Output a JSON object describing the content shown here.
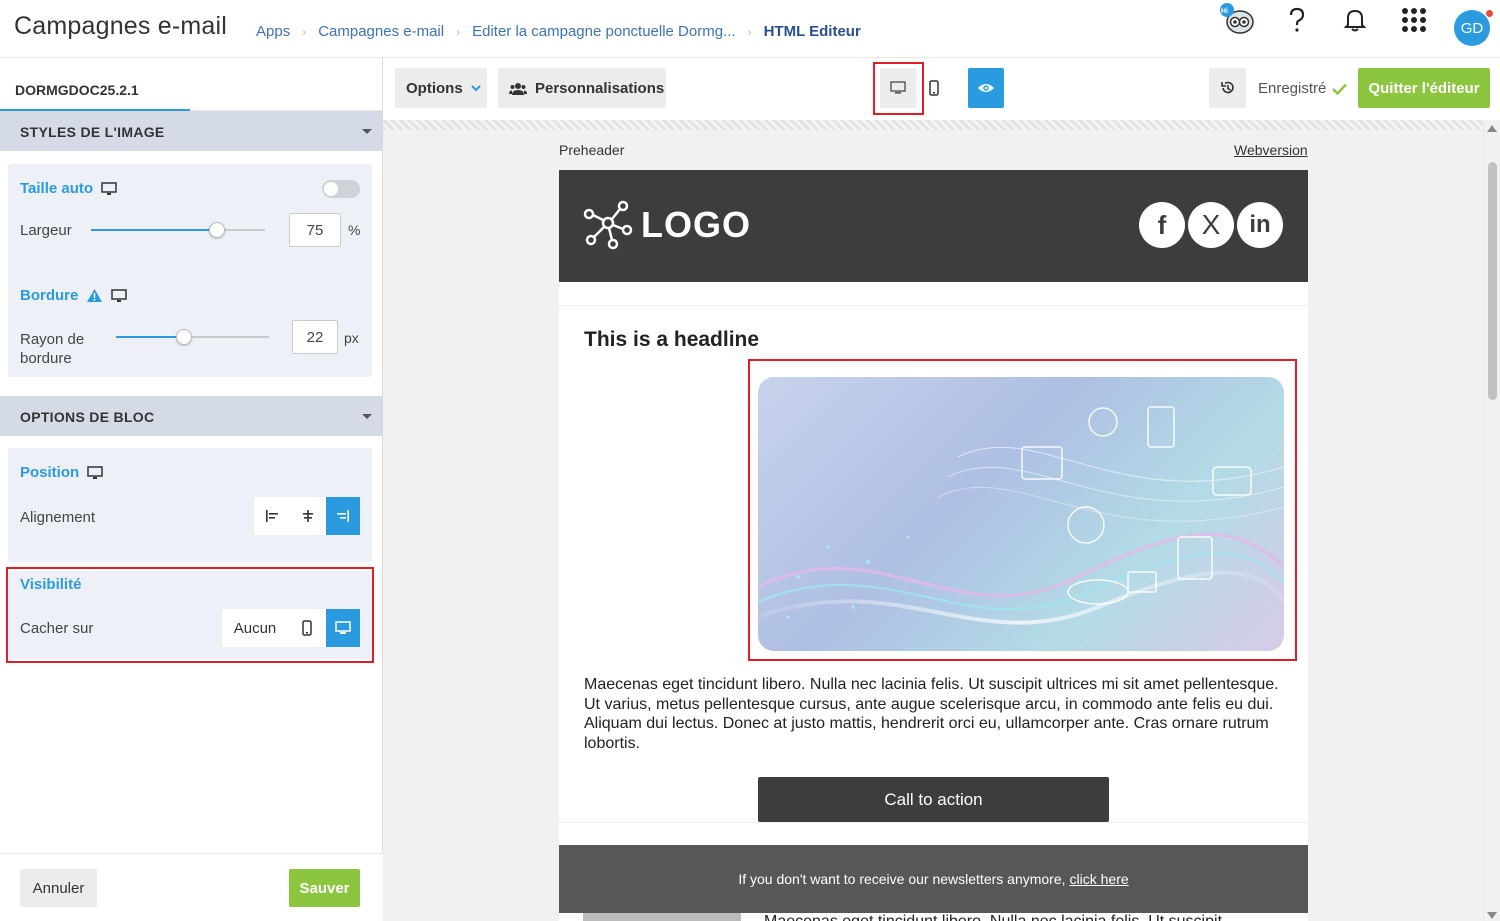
{
  "header": {
    "app_title": "Campagnes e-mail",
    "breadcrumbs": [
      "Apps",
      "Campagnes e-mail",
      "Editer la campagne ponctuelle Dormg...",
      "HTML Editeur"
    ],
    "user_initials": "GD",
    "mascot_badge": "Hi"
  },
  "left_panel": {
    "tab_label": "DORMGDOC25.2.1",
    "image_styles": {
      "section_title": "STYLES DE L'IMAGE",
      "auto_size_label": "Taille auto",
      "auto_size_enabled": false,
      "width_label": "Largeur",
      "width_value": "75",
      "width_unit": "%",
      "border_label": "Bordure",
      "radius_label": "Rayon de bordure",
      "radius_value": "22",
      "radius_unit": "px"
    },
    "block_options": {
      "section_title": "OPTIONS DE BLOC",
      "position_label": "Position",
      "alignment_label": "Alignement",
      "alignment_selected": "right"
    },
    "visibility": {
      "title": "Visibilité",
      "hide_on_label": "Cacher sur",
      "none_option": "Aucun",
      "selected": "desktop"
    },
    "cancel_label": "Annuler",
    "save_label": "Sauver"
  },
  "toolbar": {
    "options_label": "Options",
    "personalisations_label": "Personnalisations",
    "saved_label": "Enregistré",
    "quit_label": "Quitter l'éditeur",
    "active_device": "desktop"
  },
  "email": {
    "preheader": "Preheader",
    "webversion": "Webversion",
    "logo": "LOGO",
    "social": [
      "f",
      "X",
      "in"
    ],
    "headline": "This is a headline",
    "body": "Maecenas eget tincidunt libero. Nulla nec lacinia felis. Ut suscipit ultrices mi sit amet pellentesque. Ut varius, metus pellentesque cursus, ante augue scelerisque arcu, in commodo ante felis eu dui. Aliquam dui lectus. Donec at justo mattis, hendrerit orci eu, ullamcorper ante. Cras ornare rutrum lobortis.",
    "cta": "Call to action",
    "footer_text": "If you don't want to receive our newsletters anymore,",
    "footer_link": "click here",
    "next_text": "Maecenas eget tincidunt libero. Nulla nec lacinia felis. Ut suscipit"
  },
  "colors": {
    "accent": "#2b9be0",
    "success": "#8cc63f",
    "highlight": "#e01e26",
    "email_dark": "#3d3d3d"
  }
}
